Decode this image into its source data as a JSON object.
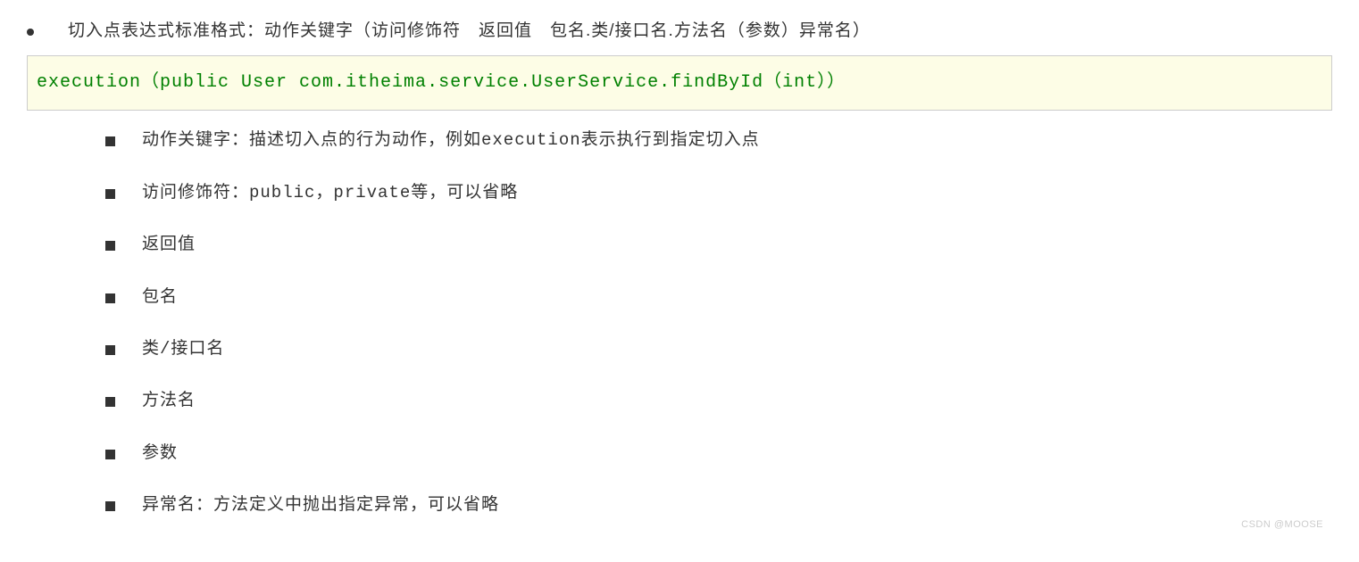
{
  "main": {
    "intro": "切入点表达式标准格式：动作关键字（访问修饰符　返回值　包名.类/接口名.方法名（参数）异常名）",
    "code": "execution（public User com.itheima.service.UserService.findById（int））",
    "items": [
      "动作关键字：描述切入点的行为动作，例如execution表示执行到指定切入点",
      "访问修饰符：public，private等，可以省略",
      "返回值",
      "包名",
      "类/接口名",
      "方法名",
      "参数",
      "异常名：方法定义中抛出指定异常，可以省略"
    ]
  },
  "watermark": "CSDN @MOOSE"
}
